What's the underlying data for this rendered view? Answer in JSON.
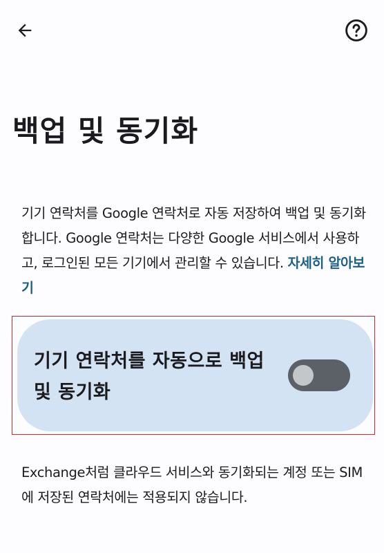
{
  "header": {
    "back_icon": "arrow-back-icon",
    "help_icon": "help-circle-icon"
  },
  "page": {
    "title": "백업 및 동기화"
  },
  "description": {
    "text": "기기 연락처를 Google 연락처로 자동 저장하여 백업 및 동기화합니다. Google 연락처는 다양한 Google 서비스에서 사용하고, 로그인된 모든 기기에서 관리할 수 있습니다. ",
    "link_label": "자세히 알아보기"
  },
  "toggle": {
    "label": "기기 연락처를 자동으로 백업 및 동기화",
    "state": "off"
  },
  "footer": {
    "note": "Exchange처럼 클라우드 서비스와 동기화되는 계정 또는 SIM에 저장된 연락처에는 적용되지 않습니다."
  },
  "colors": {
    "background": "#fdfcff",
    "card": "#d3e3f3",
    "switch_track_off": "#5c6167",
    "switch_thumb_off": "#c4c7c9",
    "link": "#1a5f8a",
    "highlight_border": "#d8262f"
  }
}
